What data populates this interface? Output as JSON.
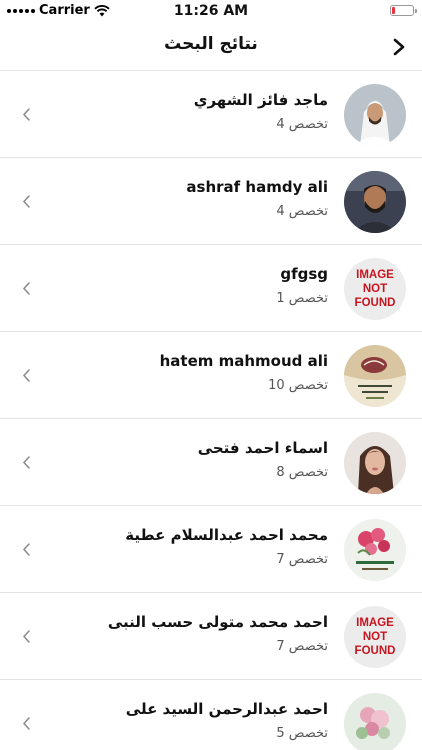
{
  "status_bar": {
    "carrier": "Carrier",
    "time": "11:26 AM",
    "battery_color": "#e8343a"
  },
  "nav": {
    "title": "نتائج البحث",
    "back_icon": "chevron-right-icon"
  },
  "results": [
    {
      "name": "ماجد فائز الشهري",
      "specialty": "تخصص 4",
      "avatar": "photo-man-white-headdress"
    },
    {
      "name": "ashraf hamdy ali",
      "specialty": "تخصص 4",
      "avatar": "photo-man-beard"
    },
    {
      "name": "gfgsg",
      "specialty": "تخصص 1",
      "avatar": "image-not-found",
      "image_placeholder": [
        "IMAGE",
        "NOT",
        "FOUND"
      ]
    },
    {
      "name": "hatem mahmoud ali",
      "specialty": "تخصص 10",
      "avatar": "photo-calligraphy"
    },
    {
      "name": "اسماء احمد فتحى",
      "specialty": "تخصص 8",
      "avatar": "photo-woman-long-hair"
    },
    {
      "name": "محمد احمد عبدالسلام عطية",
      "specialty": "تخصص 7",
      "avatar": "photo-roses-text"
    },
    {
      "name": "احمد محمد متولى حسب النبى",
      "specialty": "تخصص 7",
      "avatar": "image-not-found",
      "image_placeholder": [
        "IMAGE",
        "NOT",
        "FOUND"
      ]
    },
    {
      "name": "احمد عبدالرحمن السيد على",
      "specialty": "تخصص 5",
      "avatar": "photo-flowers"
    }
  ]
}
